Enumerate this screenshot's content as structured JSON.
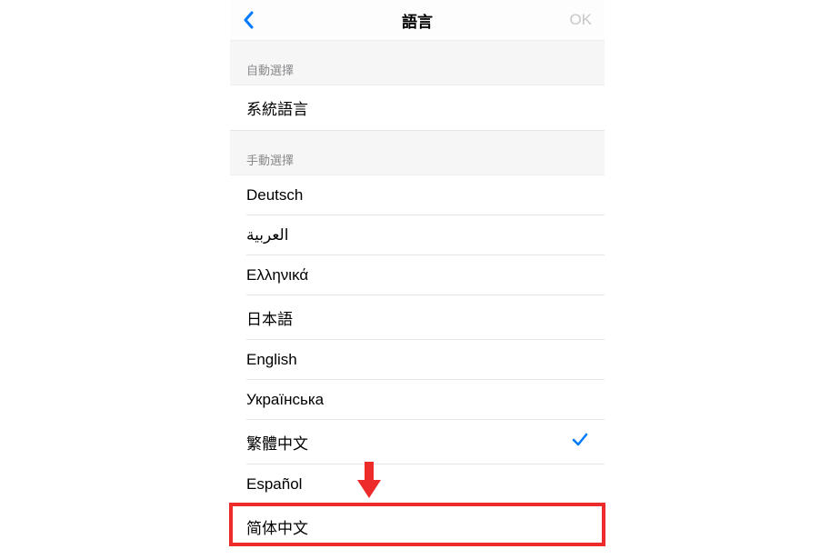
{
  "header": {
    "title": "語言",
    "ok_label": "OK"
  },
  "sections": {
    "auto": {
      "header": "自動選擇",
      "items": [
        "系統語言"
      ]
    },
    "manual": {
      "header": "手動選擇",
      "items": [
        "Deutsch",
        "العربية",
        "Ελληνικά",
        "日本語",
        "English",
        "Українська",
        "繁體中文",
        "Español",
        "简体中文"
      ],
      "selected_index": 6
    }
  },
  "annotation": {
    "color": "#ed2b2a",
    "highlight_index": 8
  }
}
